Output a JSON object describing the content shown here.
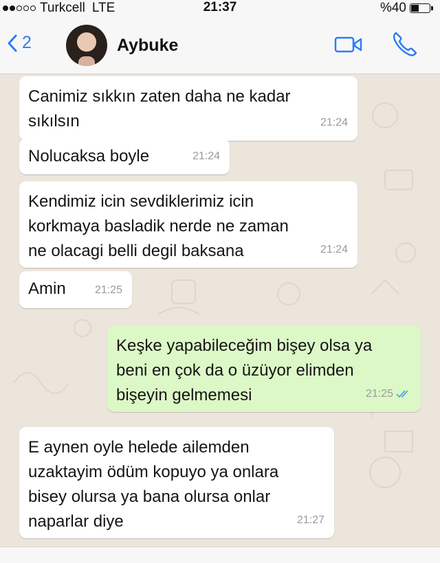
{
  "status_bar": {
    "carrier": "Turkcell",
    "network": "LTE",
    "time": "21:37",
    "battery": "%40",
    "battery_level": 0.4,
    "signal_bars_filled": 2,
    "signal_bars_total": 5
  },
  "header": {
    "back_count": "2",
    "contact_name": "Aybuke",
    "icons": {
      "back": "chevron-left-icon",
      "video": "video-camera-icon",
      "call": "phone-icon"
    },
    "accent_color": "#2f7bf5"
  },
  "messages": [
    {
      "direction": "in",
      "text": "Canimiz sıkkın zaten daha ne kadar\nsıkılsın",
      "time": "21:24"
    },
    {
      "direction": "in",
      "text": "Nolucaksa boyle",
      "time": "21:24"
    },
    {
      "direction": "in",
      "text": "Kendimiz icin sevdiklerimiz icin\nkorkmaya basladik nerde ne zaman\nne olacagi belli degil baksana",
      "time": "21:24"
    },
    {
      "direction": "in",
      "text": "Amin",
      "time": "21:25"
    },
    {
      "direction": "out",
      "text": "Keşke yapabileceğim bişey olsa ya\nbeni en çok da o üzüyor elimden\nbişeyin gelmemesi",
      "time": "21:25",
      "status": "read"
    },
    {
      "direction": "in",
      "text": "E aynen oyle helede ailemden\nuzaktayim ödüm kopuyo ya onlara\nbisey olursa ya bana olursa onlar\nnaparlar diye",
      "time": "21:27"
    }
  ],
  "colors": {
    "incoming_bubble": "#ffffff",
    "outgoing_bubble": "#dcf8c6",
    "chat_background": "#ece5dc",
    "read_ticks": "#4fa6e0"
  }
}
